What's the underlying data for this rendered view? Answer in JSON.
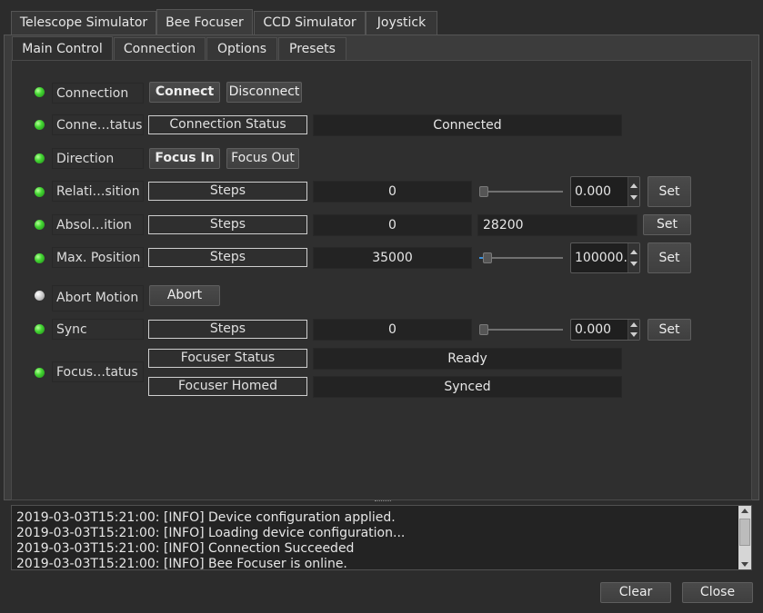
{
  "top_tabs": [
    {
      "label": "Telescope Simulator",
      "ul": "T"
    },
    {
      "label": "Bee Focuser",
      "ul": "B"
    },
    {
      "label": "CCD Simulator",
      "ul": "S"
    },
    {
      "label": "Joystick",
      "ul": "J"
    }
  ],
  "sub_tabs": [
    "Main Control",
    "Connection",
    "Options",
    "Presets"
  ],
  "colors": {
    "ok": "#44d633",
    "idle": "#cfcfcf"
  },
  "rows": {
    "connection": {
      "label": "Connection",
      "status": "ok",
      "connect": "Connect",
      "disconnect": "Disconnect"
    },
    "conn_status": {
      "label": "Conne…tatus",
      "status": "ok",
      "sublabel": "Connection Status",
      "value": "Connected"
    },
    "direction": {
      "label": "Direction",
      "status": "ok",
      "focus_in": "Focus In",
      "focus_out": "Focus Out"
    },
    "relative": {
      "label": "Relati…sition",
      "status": "ok",
      "sublabel": "Steps",
      "value": "0",
      "spin": "0.000",
      "slider": 0.0,
      "set": "Set"
    },
    "absolute": {
      "label": "Absol…ition",
      "status": "ok",
      "sublabel": "Steps",
      "value": "0",
      "input": "28200",
      "set": "Set"
    },
    "maxpos": {
      "label": "Max. Position",
      "status": "ok",
      "sublabel": "Steps",
      "value": "35000",
      "spin": "100000.0",
      "slider": 0.05,
      "set": "Set"
    },
    "abort": {
      "label": "Abort Motion",
      "status": "idle",
      "button": "Abort"
    },
    "sync": {
      "label": "Sync",
      "status": "ok",
      "sublabel": "Steps",
      "value": "0",
      "spin": "0.000",
      "slider": 0.0,
      "set": "Set"
    },
    "focuser_status": {
      "label": "Focus…tatus",
      "status": "ok",
      "items": [
        {
          "sublabel": "Focuser Status",
          "value": "Ready"
        },
        {
          "sublabel": "Focuser Homed",
          "value": "Synced"
        }
      ]
    }
  },
  "log": [
    "2019-03-03T15:21:00: [INFO] Device configuration applied.",
    "2019-03-03T15:21:00: [INFO] Loading device configuration...",
    "2019-03-03T15:21:00: [INFO] Connection Succeeded",
    "2019-03-03T15:21:00: [INFO] Bee Focuser is online."
  ],
  "footer": {
    "clear": "Clear",
    "close": "Close"
  }
}
